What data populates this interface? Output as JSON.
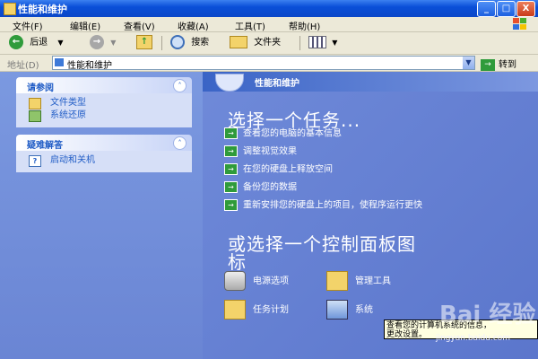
{
  "window": {
    "title": "性能和维护",
    "buttons": {
      "minimize": "_",
      "maximize": "□",
      "close": "X"
    }
  },
  "menubar": {
    "items": [
      "文件(F)",
      "编辑(E)",
      "查看(V)",
      "收藏(A)",
      "工具(T)",
      "帮助(H)"
    ]
  },
  "toolbar": {
    "back_label": "后退",
    "search_label": "搜索",
    "folders_label": "文件夹"
  },
  "address": {
    "label": "地址(D)",
    "value": "性能和维护",
    "go_label": "转到"
  },
  "left_pane": {
    "see_also": {
      "title": "请参阅",
      "items": [
        "文件类型",
        "系统还原"
      ]
    },
    "troubleshoot": {
      "title": "疑难解答",
      "items": [
        "启动和关机"
      ]
    }
  },
  "right_pane": {
    "header_title": "性能和维护",
    "task_heading": "选择一个任务...",
    "tasks": [
      "查看您的电脑的基本信息",
      "调整视觉效果",
      "在您的硬盘上释放空间",
      "备份您的数据",
      "重新安排您的硬盘上的项目，使程序运行更快"
    ],
    "cp_heading_line1": "或选择一个控制面板图",
    "cp_heading_line2": "标",
    "cp_icons": [
      "电源选项",
      "管理工具",
      "任务计划",
      "系统"
    ]
  },
  "tooltip": {
    "line1": "查看您的计算机系统的信息，",
    "line2": "更改设置。"
  },
  "watermark": {
    "brand": "Bai 经验",
    "url": "jingyan.baidu.com"
  },
  "colors": {
    "accent": "#215dc6",
    "go_green": "#2f9b3b",
    "titlebar": "#0a4fd8"
  }
}
